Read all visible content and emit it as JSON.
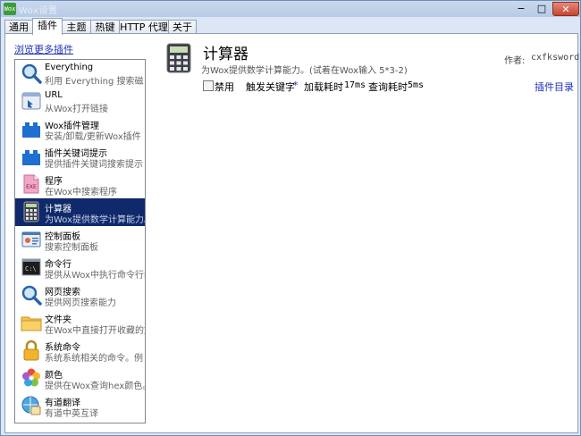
{
  "window": {
    "title": "Wox设置",
    "app_icon": "Wox",
    "min_label": "−",
    "max_label": "□",
    "close_label": "✕"
  },
  "tabs": [
    {
      "label": "通用"
    },
    {
      "label": "插件"
    },
    {
      "label": "主题"
    },
    {
      "label": "热键"
    },
    {
      "label": "HTTP 代理"
    },
    {
      "label": "关于"
    }
  ],
  "active_tab": "插件",
  "browse_more": "浏览更多插件",
  "plugins": [
    {
      "title": "Everything",
      "subtitle": "利用 Everything 搜索磁",
      "icon": "magnifier-icon"
    },
    {
      "title": "URL",
      "subtitle": "从Wox打开链接",
      "icon": "url-icon"
    },
    {
      "title": "Wox插件管理",
      "subtitle": "安装/卸载/更新Wox插件",
      "icon": "puzzle-icon"
    },
    {
      "title": "插件关键词提示",
      "subtitle": "提供插件关键词搜索提示",
      "icon": "puzzle-icon"
    },
    {
      "title": "程序",
      "subtitle": "在Wox中搜索程序",
      "icon": "exe-icon"
    },
    {
      "title": "计算器",
      "subtitle": "为Wox提供数学计算能力。",
      "icon": "calculator-icon"
    },
    {
      "title": "控制面板",
      "subtitle": "搜索控制面板",
      "icon": "control-panel-icon"
    },
    {
      "title": "命令行",
      "subtitle": "提供从Wox中执行命令行的",
      "icon": "terminal-icon"
    },
    {
      "title": "网页搜索",
      "subtitle": "提供网页搜索能力",
      "icon": "magnifier-icon"
    },
    {
      "title": "文件夹",
      "subtitle": "在Wox中直接打开收藏的文",
      "icon": "folder-icon"
    },
    {
      "title": "系统命令",
      "subtitle": "系统系统相关的命令。例",
      "icon": "lock-icon"
    },
    {
      "title": "颜色",
      "subtitle": "提供在Wox查询hex颜色。",
      "icon": "color-icon"
    },
    {
      "title": "有道翻译",
      "subtitle": "有道中英互译",
      "icon": "translate-icon"
    }
  ],
  "selected_plugin": "计算器",
  "detail": {
    "name": "计算器",
    "description": "为Wox提供数学计算能力。(试着在Wox输入 5*3-2)",
    "author_label": "作者:",
    "author": "cxfksword",
    "disable_label": "禁用",
    "disabled": false,
    "trigger_label": "触发关键字",
    "trigger_value": "*",
    "load_time_label": "加载耗时",
    "load_time": "17ms",
    "query_time_label": "查询耗时",
    "query_time": "5ms",
    "plugin_dir": "插件目录"
  },
  "colors": {
    "selected_bg": "#10296b",
    "link": "#1b2fb7",
    "title_bar": "#bccfe8"
  }
}
